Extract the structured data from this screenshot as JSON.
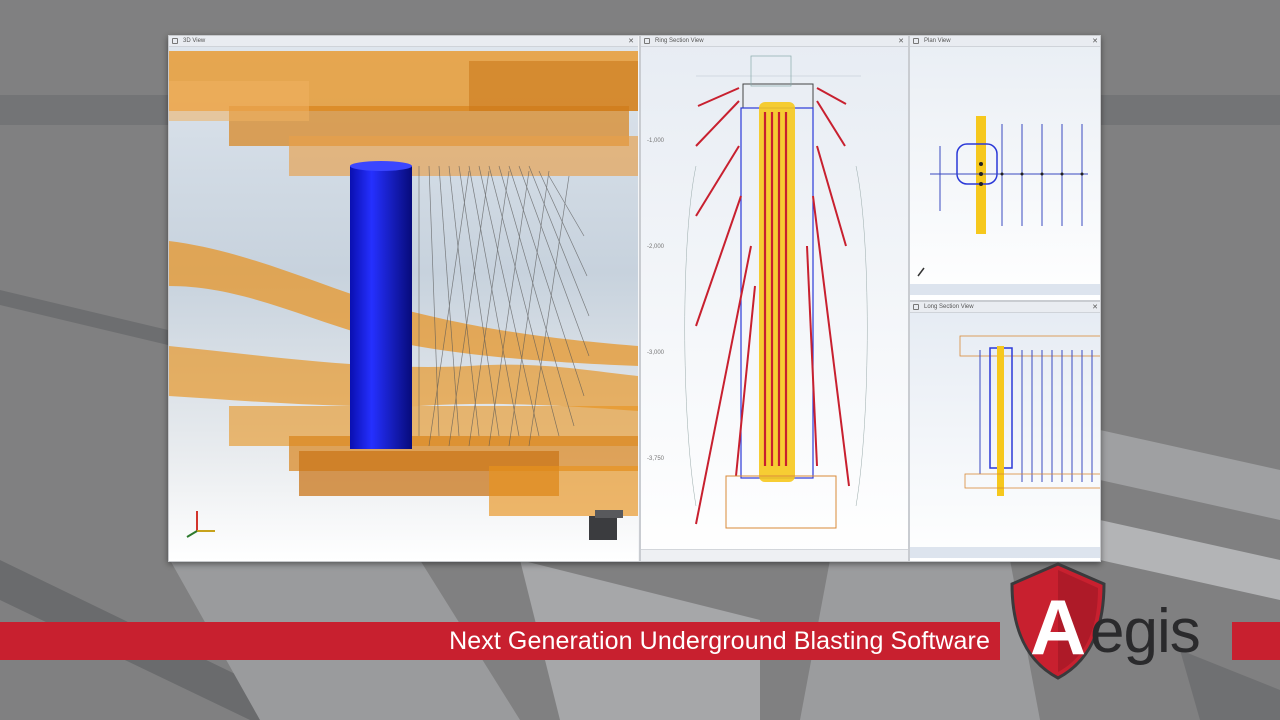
{
  "background": {
    "color": "#808081",
    "stripe_light": "#b7b8ba",
    "stripe_dark": "#5e5f61"
  },
  "window": {
    "panes": {
      "view3d": {
        "title": "3D View",
        "close_glyph": "✕"
      },
      "section": {
        "title": "Ring Section View",
        "close_glyph": "✕"
      },
      "plan": {
        "title": "Plan View",
        "close_glyph": "✕"
      },
      "longsection": {
        "title": "Long Section View",
        "close_glyph": "✕"
      }
    },
    "section_axis_labels": [
      "-1,000",
      "-2,000",
      "-3,000",
      "-3,750"
    ]
  },
  "colors": {
    "accent": "#c8202f",
    "drive": "#e8921c",
    "raise": "#1d2bd6",
    "blast_hole": "#c8202f",
    "charge": "#f6c81d"
  },
  "icons": [
    "axis-triad-icon",
    "view-cube-icon",
    "aegis-shield-logo-icon"
  ],
  "banner": {
    "tagline": "Next Generation Underground Blasting Software"
  },
  "brand": {
    "logo_text": "egis",
    "logo_letter": "A"
  }
}
